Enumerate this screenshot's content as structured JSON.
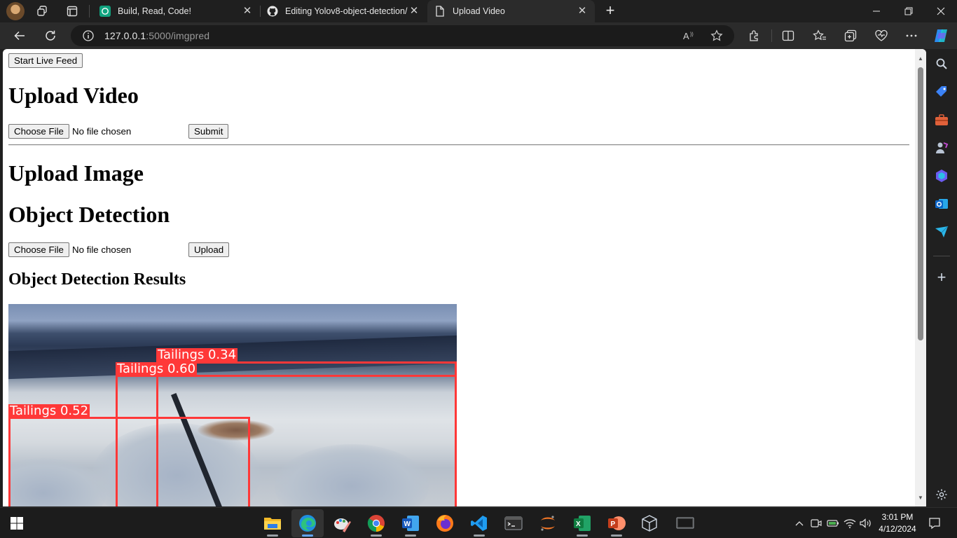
{
  "browser": {
    "tabs": [
      {
        "title": "Build, Read, Code!",
        "active": false,
        "favicon": "chatgpt-icon"
      },
      {
        "title": "Editing Yolov8-object-detection/",
        "active": false,
        "favicon": "github-icon"
      },
      {
        "title": "Upload Video",
        "active": true,
        "favicon": "page-icon"
      }
    ],
    "address": {
      "host": "127.0.0.1",
      "path": ":5000/imgpred"
    }
  },
  "page": {
    "live_feed_button": "Start Live Feed",
    "video_heading": "Upload Video",
    "video_form": {
      "choose_label": "Choose File",
      "file_status": "No file chosen",
      "submit_label": "Submit"
    },
    "image_heading": "Upload Image",
    "detection_heading": "Object Detection",
    "image_form": {
      "choose_label": "Choose File",
      "file_status": "No file chosen",
      "upload_label": "Upload"
    },
    "results_heading": "Object Detection Results",
    "detections": [
      {
        "label": "Tailings 0.34"
      },
      {
        "label": "Tailings 0.60"
      },
      {
        "label": "Tailings 0.52"
      }
    ]
  },
  "taskbar": {
    "apps": [
      "file-explorer-icon",
      "edge-icon",
      "paint-icon",
      "chrome-icon",
      "word-icon",
      "firefox-icon",
      "vscode-icon",
      "terminal-icon",
      "jupyter-icon",
      "excel-icon",
      "powerpoint-icon",
      "virtualbox-icon",
      "monitor-icon"
    ],
    "time": "3:01 PM",
    "date": "4/12/2024"
  },
  "colors": {
    "detection_box": "#ff3838",
    "accent": "#0078d4"
  }
}
